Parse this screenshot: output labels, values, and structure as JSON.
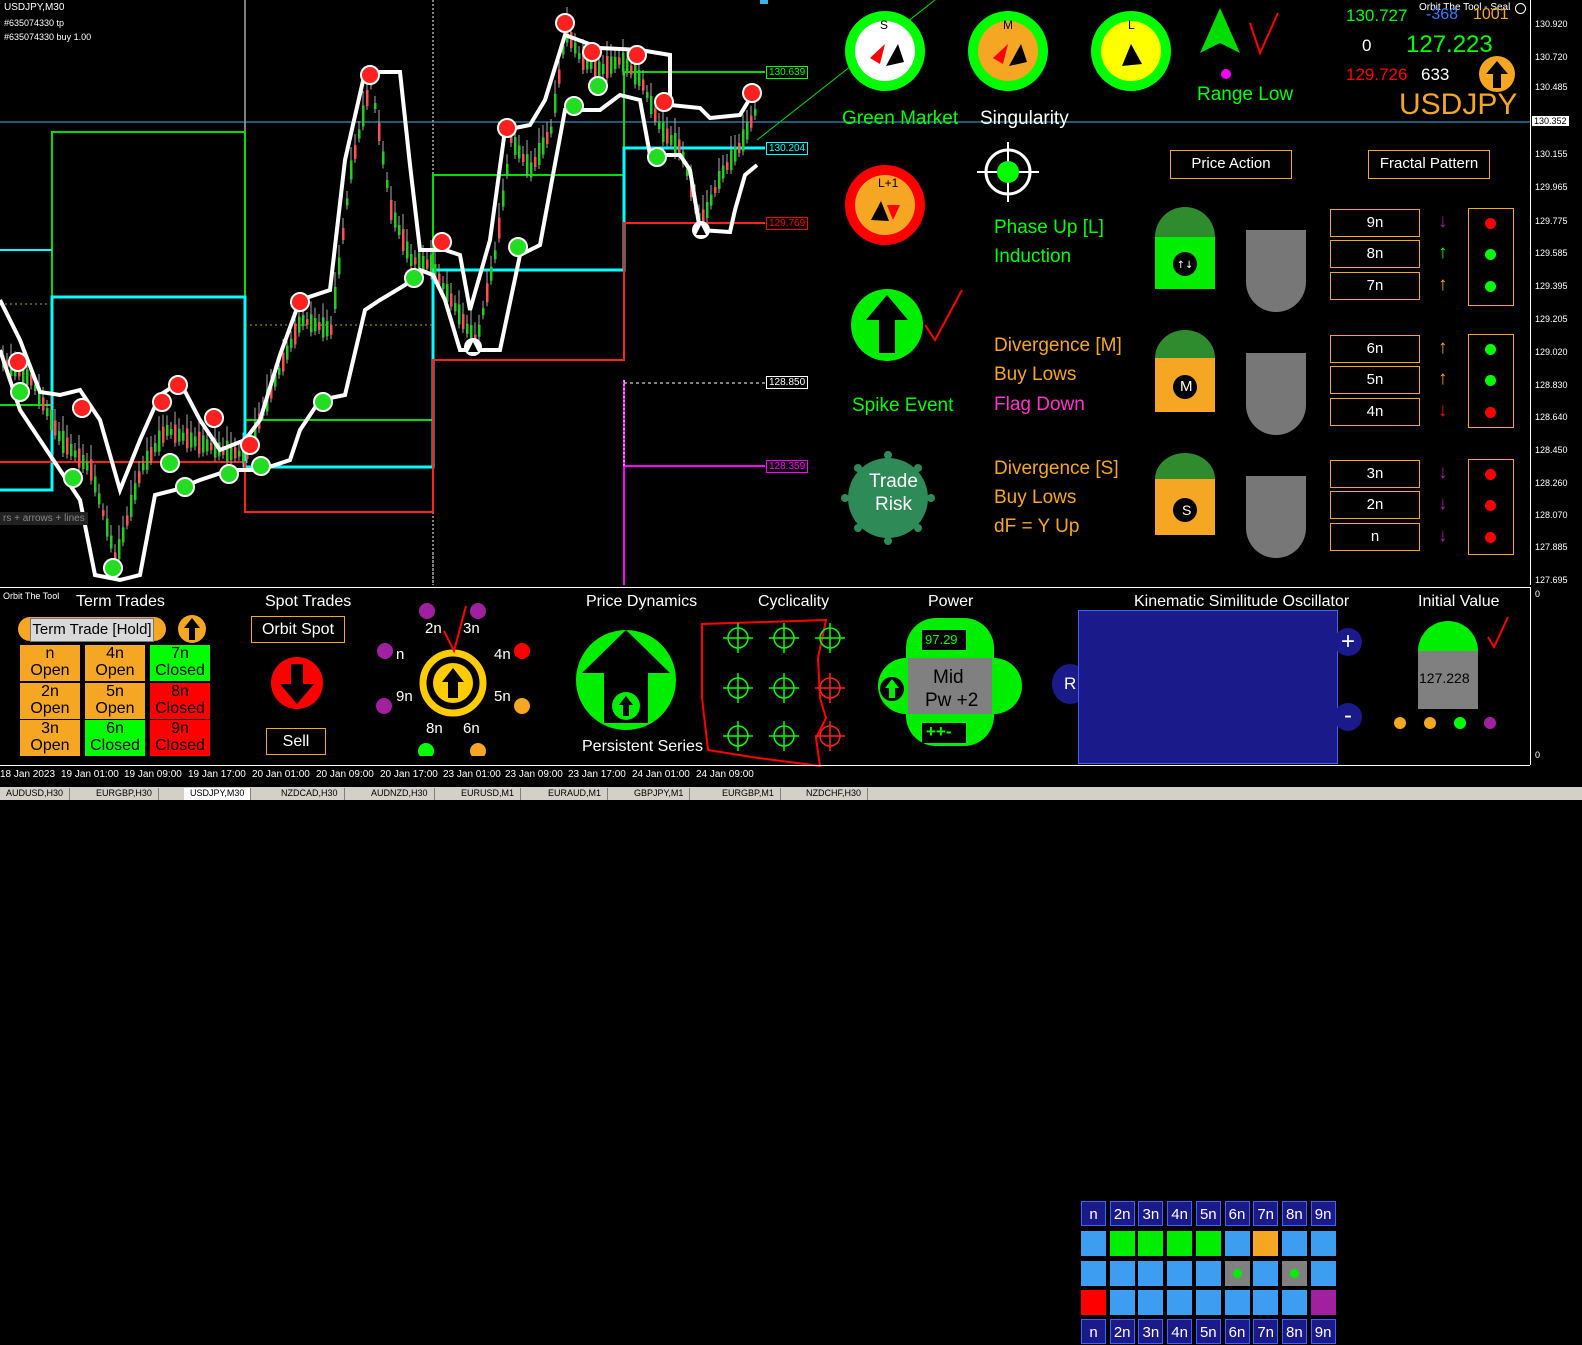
{
  "window": {
    "symbol": "USDJPY,M30",
    "order_line_1": "#635074330 tp",
    "order_line_2": "#635074330 buy 1.00",
    "indicator_name": "Orbit The Tool - Seal",
    "indicator_name_small": "Orbit The Tool",
    "overlay_hint": "rs + arrows + lines"
  },
  "colors": {
    "background": "#000000",
    "green": "#00ff00",
    "orange": "#f5a623",
    "red": "#ff0000",
    "cyan": "#00ffff",
    "magenta": "#ff00ff",
    "purple": "#a020a0",
    "yellow": "#ffff00"
  },
  "price_axis": {
    "ticks": [
      "130.920",
      "130.720",
      "130.485",
      "130.155",
      "129.965",
      "129.775",
      "129.585",
      "129.395",
      "129.205",
      "129.020",
      "128.830",
      "128.640",
      "128.450",
      "128.260",
      "128.070",
      "127.885",
      "127.695"
    ],
    "current_price": "130.352"
  },
  "levels": [
    {
      "label": "130.639",
      "color": "#00ff00"
    },
    {
      "label": "130.204",
      "color": "#00ffff"
    },
    {
      "label": "129.769",
      "color": "#ff0000"
    },
    {
      "label": "128.850",
      "color": "#ffffff"
    },
    {
      "label": "128.359",
      "color": "#ff00ff"
    }
  ],
  "header_stats": {
    "high": "130.727",
    "delta": "-368",
    "count": "1001",
    "zero": "0",
    "price": "127.223",
    "low": "129.726",
    "spread": "633",
    "symbol": "USDJPY"
  },
  "gauges": [
    {
      "label": "S"
    },
    {
      "label": "M"
    },
    {
      "label": "L"
    },
    {
      "label": "L+1"
    }
  ],
  "market": {
    "state": "Green Market",
    "singularity": "Singularity",
    "range": "Range Low",
    "spike": "Spike Event",
    "trade_risk_1": "Trade",
    "trade_risk_2": "Risk"
  },
  "buttons": {
    "price_action": "Price Action",
    "fractal_pattern": "Fractal Pattern"
  },
  "phases": {
    "l_title": "Phase Up [L]",
    "l_sub": "Induction",
    "m_title": "Divergence [M]",
    "m_sub1": "Buy Lows",
    "m_sub2": "Flag Down",
    "s_title": "Divergence [S]",
    "s_sub1": "Buy Lows",
    "s_sub2": "dF = Y Up",
    "m_badge": "M",
    "s_badge": "S"
  },
  "fractal_rows": [
    {
      "label": "9n",
      "arrow": "↓",
      "arrow_color": "#a020a0",
      "dot": "#ff0000"
    },
    {
      "label": "8n",
      "arrow": "↑",
      "arrow_color": "#00ff00",
      "dot": "#00ff00"
    },
    {
      "label": "7n",
      "arrow": "↑",
      "arrow_color": "#f5a623",
      "dot": "#00ff00"
    },
    {
      "label": "6n",
      "arrow": "↑",
      "arrow_color": "#f5a623",
      "dot": "#00ff00"
    },
    {
      "label": "5n",
      "arrow": "↑",
      "arrow_color": "#f5a623",
      "dot": "#00ff00"
    },
    {
      "label": "4n",
      "arrow": "↓",
      "arrow_color": "#ff0000",
      "dot": "#ff0000"
    },
    {
      "label": "3n",
      "arrow": "↓",
      "arrow_color": "#a020a0",
      "dot": "#ff0000"
    },
    {
      "label": "2n",
      "arrow": "↓",
      "arrow_color": "#a020a0",
      "dot": "#ff0000"
    },
    {
      "label": "n",
      "arrow": "↓",
      "arrow_color": "#a020a0",
      "dot": "#ff0000"
    }
  ],
  "panel": {
    "term_trades_title": "Term Trades",
    "term_trade_button": "Term Trade [Hold]",
    "term_cells": [
      {
        "l1": "n",
        "l2": "Open",
        "bg": "#f5a623"
      },
      {
        "l1": "4n",
        "l2": "Open",
        "bg": "#f5a623"
      },
      {
        "l1": "7n",
        "l2": "Closed",
        "bg": "#00ff00"
      },
      {
        "l1": "2n",
        "l2": "Open",
        "bg": "#f5a623"
      },
      {
        "l1": "5n",
        "l2": "Open",
        "bg": "#f5a623"
      },
      {
        "l1": "8n",
        "l2": "Closed",
        "bg": "#ff0000"
      },
      {
        "l1": "3n",
        "l2": "Open",
        "bg": "#f5a623"
      },
      {
        "l1": "6n",
        "l2": "Closed",
        "bg": "#00ff00"
      },
      {
        "l1": "9n",
        "l2": "Closed",
        "bg": "#ff0000"
      }
    ],
    "spot_trades_title": "Spot Trades",
    "orbit_spot": "Orbit Spot",
    "sell": "Sell",
    "orbit_labels": [
      "2n",
      "3n",
      "n",
      "4n",
      "9n",
      "5n",
      "8n",
      "6n"
    ],
    "price_dynamics_title": "Price Dynamics",
    "persistent_series": "Persistent Series",
    "cyclicality_title": "Cyclicality",
    "power_title": "Power",
    "power_value": "97.29",
    "power_mid_1": "Mid",
    "power_mid_2": "Pw +2",
    "power_bottom": "++-",
    "kso_title": "Kinematic Similitude Oscillator",
    "kso_labels": [
      "n",
      "2n",
      "3n",
      "4n",
      "5n",
      "6n",
      "7n",
      "8n",
      "9n"
    ],
    "kso_r": "R",
    "kso_plus": "+",
    "kso_minus": "-",
    "initial_value_title": "Initial Value",
    "initial_value": "127.228",
    "sub_axis_top": "0",
    "sub_axis_bottom": "0"
  },
  "time_axis": [
    "18 Jan 2023",
    "19 Jan 01:00",
    "19 Jan 09:00",
    "19 Jan 17:00",
    "20 Jan 01:00",
    "20 Jan 09:00",
    "20 Jan 17:00",
    "23 Jan 01:00",
    "23 Jan 09:00",
    "23 Jan 17:00",
    "24 Jan 01:00",
    "24 Jan 09:00"
  ],
  "tabs": [
    "AUDUSD,H30",
    "EURGBP,H30",
    "USDJPY,M30",
    "NZDCAD,H30",
    "AUDNZD,H30",
    "EURUSD,M1",
    "EURAUD,M1",
    "GBPJPY,M1",
    "EURGBP,M1",
    "NZDCHF,H30"
  ]
}
